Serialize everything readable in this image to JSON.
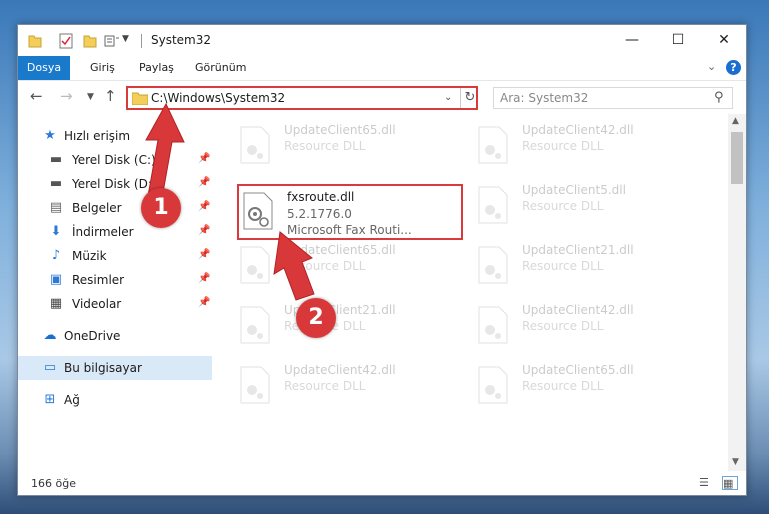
{
  "window": {
    "title": "System32",
    "controls": {
      "minimize": "—",
      "maximize": "☐",
      "close": "✕"
    }
  },
  "ribbon": {
    "tabs": [
      "Dosya",
      "Giriş",
      "Paylaş",
      "Görünüm"
    ]
  },
  "nav": {
    "address": "C:\\Windows\\System32",
    "search_placeholder": "Ara: System32"
  },
  "sidebar": {
    "items": [
      {
        "label": "Hızlı erişim",
        "icon": "star-icon"
      },
      {
        "label": "Yerel Disk (C:)",
        "icon": "drive-icon"
      },
      {
        "label": "Yerel Disk (D:)",
        "icon": "drive-icon"
      },
      {
        "label": "Belgeler",
        "icon": "documents-icon"
      },
      {
        "label": "İndirmeler",
        "icon": "download-icon"
      },
      {
        "label": "Müzik",
        "icon": "music-icon"
      },
      {
        "label": "Resimler",
        "icon": "pictures-icon"
      },
      {
        "label": "Videolar",
        "icon": "video-icon"
      },
      {
        "label": "OneDrive",
        "icon": "cloud-icon"
      },
      {
        "label": "Bu bilgisayar",
        "icon": "computer-icon"
      },
      {
        "label": "Ağ",
        "icon": "network-icon"
      }
    ]
  },
  "files": {
    "highlighted": {
      "name": "fxsroute.dll",
      "version": "5.2.1776.0",
      "description": "Microsoft Fax Routi..."
    },
    "left_column": [
      {
        "name": "UpdateClient65.dll",
        "desc": "Resource DLL"
      },
      {
        "name": "UpdateClient65.dll",
        "desc": "Resource DLL"
      },
      {
        "name": "UpdateClient21.dll",
        "desc": "Resource DLL"
      },
      {
        "name": "UpdateClient42.dll",
        "desc": "Resource DLL"
      }
    ],
    "right_column": [
      {
        "name": "UpdateClient42.dll",
        "desc": "Resource DLL"
      },
      {
        "name": "UpdateClient5.dll",
        "desc": "Resource DLL"
      },
      {
        "name": "UpdateClient21.dll",
        "desc": "Resource DLL"
      },
      {
        "name": "UpdateClient42.dll",
        "desc": "Resource DLL"
      },
      {
        "name": "UpdateClient65.dll",
        "desc": "Resource DLL"
      }
    ]
  },
  "status": {
    "item_count": "166 öğe"
  },
  "callouts": {
    "one": "1",
    "two": "2"
  },
  "colors": {
    "accent": "#1979ca",
    "highlight_border": "#d93a3a",
    "callout": "#d9383a"
  }
}
